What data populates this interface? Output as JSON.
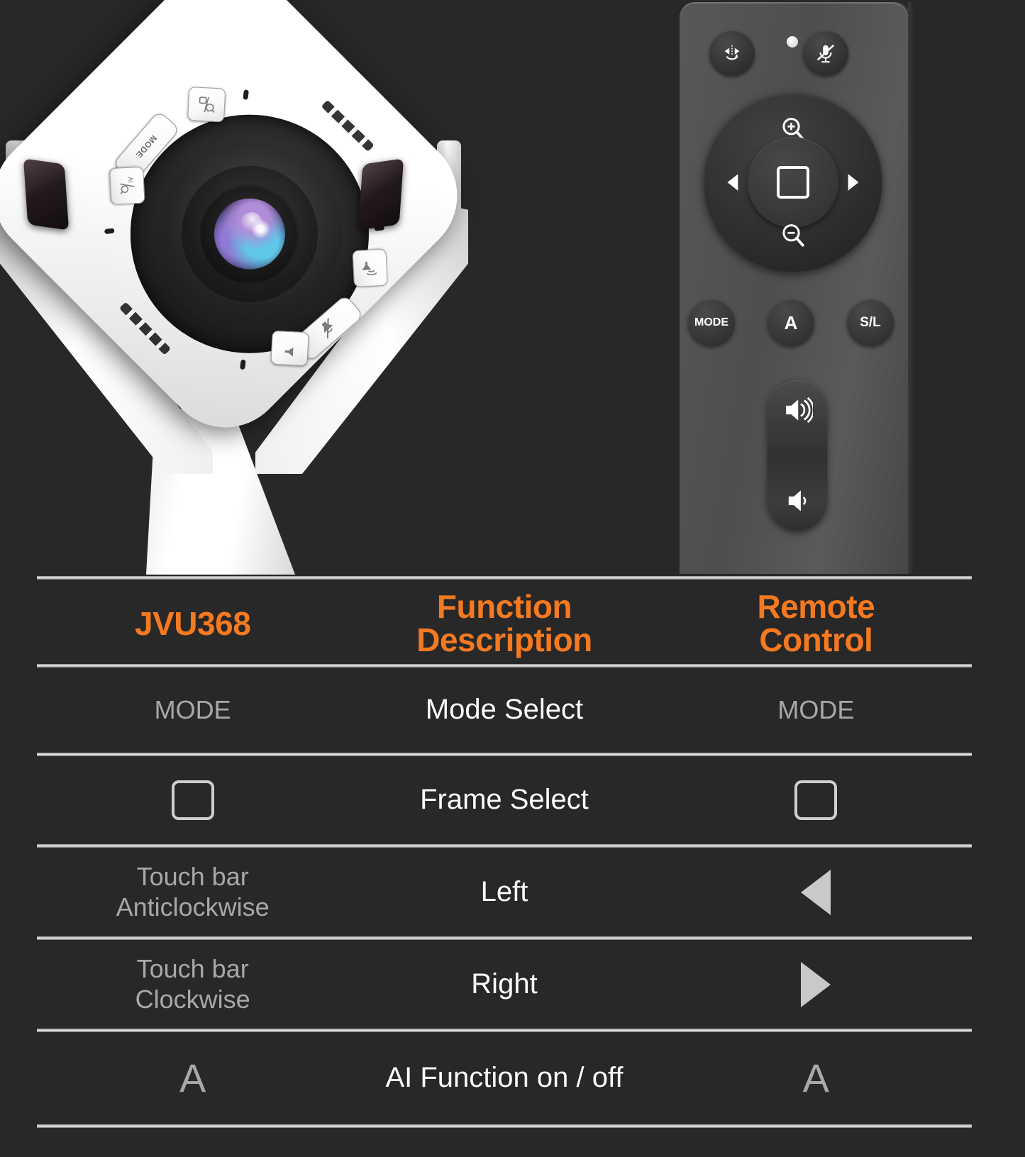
{
  "product": {
    "camera": {
      "buttons": [
        {
          "name": "frame-zoom-button",
          "icon": "frame-magnifier-icon",
          "label": ""
        },
        {
          "name": "mode-button",
          "icon": "",
          "label": "MODE"
        },
        {
          "name": "ai-zoom-button",
          "icon": "ai-magnifier-icon",
          "label": "AI / Q"
        },
        {
          "name": "volume-up-button",
          "icon": "speaker-waves-icon",
          "label": ""
        },
        {
          "name": "mute-button",
          "icon": "speaker-mute-icon",
          "label": ""
        },
        {
          "name": "volume-down-button",
          "icon": "speaker-icon",
          "label": ""
        }
      ]
    },
    "remote": {
      "top_buttons": [
        {
          "name": "mirror-flip-button",
          "icon": "mirror-flip-icon"
        },
        {
          "name": "mic-mute-button",
          "icon": "mic-mute-icon"
        }
      ],
      "led_indicator": "led-indicator",
      "dpad": {
        "zoom_in": "zoom-in-icon",
        "zoom_out": "zoom-out-icon",
        "left": "arrow-left-icon",
        "right": "arrow-right-icon",
        "center": "frame-square-icon"
      },
      "function_buttons": [
        {
          "name": "remote-mode-button",
          "label": "MODE"
        },
        {
          "name": "remote-a-button",
          "label": "A"
        },
        {
          "name": "remote-sl-button",
          "label": "S/L"
        }
      ],
      "volume": {
        "up": "volume-up-icon",
        "down": "volume-down-icon"
      }
    }
  },
  "table": {
    "headers": {
      "left": "JVU368",
      "center_line1": "Function",
      "center_line2": "Description",
      "right_line1": "Remote",
      "right_line2": "Control"
    },
    "rows": [
      {
        "left_type": "text",
        "left": "MODE",
        "center": "Mode Select",
        "right_type": "text",
        "right": "MODE"
      },
      {
        "left_type": "square",
        "left": "",
        "center": "Frame Select",
        "right_type": "square",
        "right": ""
      },
      {
        "left_type": "text",
        "left": "Touch bar\nAnticlockwise",
        "center": "Left",
        "right_type": "triangle-left",
        "right": ""
      },
      {
        "left_type": "text",
        "left": "Touch bar\nClockwise",
        "center": "Right",
        "right_type": "triangle-right",
        "right": ""
      },
      {
        "left_type": "text",
        "left": "A",
        "center": "AI Function on / off",
        "right_type": "text",
        "right": "A"
      }
    ]
  },
  "colors": {
    "background": "#282828",
    "accent_orange": "#F47920",
    "side_text": "#A8A8A8",
    "center_text": "#FDFDFD",
    "divider": "#D8D8D8"
  }
}
